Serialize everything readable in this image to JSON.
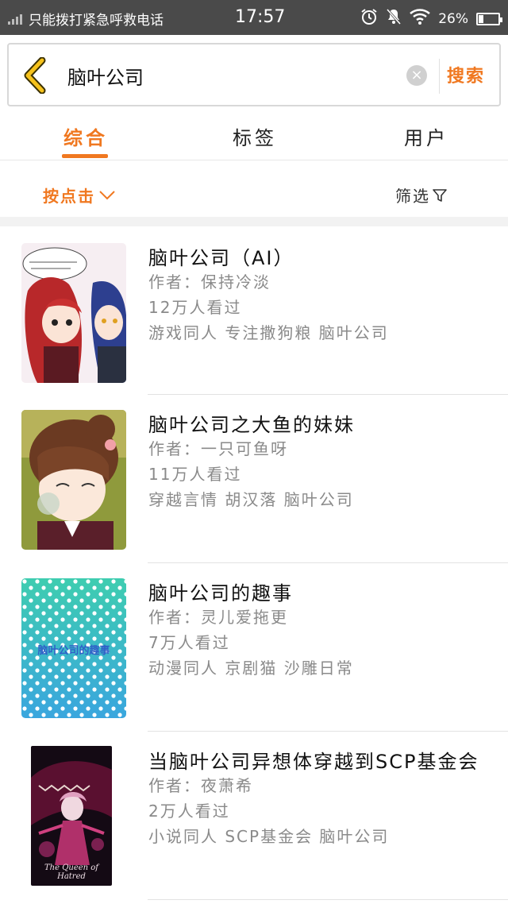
{
  "status_bar": {
    "carrier_text": "只能拨打紧急呼救电话",
    "time": "17:57",
    "battery_text": "26%",
    "battery_level": 0.26,
    "icons": [
      "signal-icon",
      "alarm-icon",
      "mute-icon",
      "wifi-icon",
      "battery-icon"
    ]
  },
  "search": {
    "query": "脑叶公司",
    "clear_symbol": "×",
    "button_label": "搜索"
  },
  "tabs": [
    {
      "label": "综合",
      "active": true
    },
    {
      "label": "标签",
      "active": false
    },
    {
      "label": "用户",
      "active": false
    }
  ],
  "sort": {
    "label": "按点击",
    "filter_label": "筛选"
  },
  "results": [
    {
      "title": "脑叶公司（AI）",
      "author": "作者：保持冷淡",
      "views": "12万人看过",
      "tags": "游戏同人 专注撒狗粮 脑叶公司",
      "cover": "comic-characters-red-blue"
    },
    {
      "title": "脑叶公司之大鱼的妹妹",
      "author": "作者：一只可鱼呀",
      "views": "11万人看过",
      "tags": "穿越言情 胡汉落 脑叶公司",
      "cover": "comic-girl-brown-hair"
    },
    {
      "title": "脑叶公司的趣事",
      "author": "作者：灵儿爱拖更",
      "views": "7万人看过",
      "tags": "动漫同人 京剧猫 沙雕日常",
      "cover_text": "脑叶公司的趣事",
      "cover": "teal-polka-dot"
    },
    {
      "title": "当脑叶公司异想体穿越到SCP基金会",
      "author": "作者：夜萧希",
      "views": "2万人看过",
      "tags": "小说同人 SCP基金会 脑叶公司",
      "cover_text": "The Queen of Hatred",
      "cover": "dark-monster-art"
    }
  ],
  "colors": {
    "accent": "#f07820",
    "status_bar": "#4a4a4a",
    "meta_text": "#8a8a8a",
    "cover_teal": "#3fc4b6"
  }
}
